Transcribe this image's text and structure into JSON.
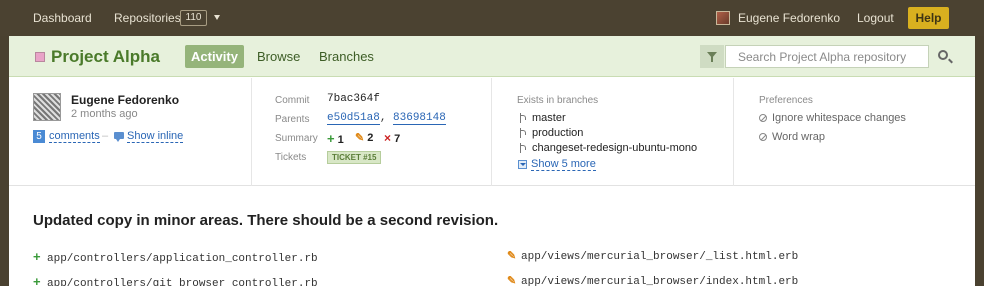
{
  "topnav": {
    "dashboard": "Dashboard",
    "repositories": "Repositories",
    "repo_count": "110",
    "user_name": "Eugene Fedorenko",
    "logout": "Logout",
    "help": "Help"
  },
  "project": {
    "title": "Project Alpha",
    "tabs": [
      {
        "label": "Activity",
        "active": true
      },
      {
        "label": "Browse",
        "active": false
      },
      {
        "label": "Branches",
        "active": false
      }
    ],
    "search_placeholder": "Search Project Alpha repository"
  },
  "author": {
    "name": "Eugene Fedorenko",
    "time": "2 months ago",
    "comments_count": "5",
    "comments_label": "comments",
    "separator": "–",
    "show_inline": "Show inline"
  },
  "commit": {
    "commit_label": "Commit",
    "hash": "7bac364f",
    "parents_label": "Parents",
    "parents": [
      "e50d51a8",
      "83698148"
    ],
    "parents_separator": ",",
    "summary_label": "Summary",
    "added": "1",
    "modified": "2",
    "deleted": "7",
    "tickets_label": "Tickets",
    "ticket": "TICKET #15"
  },
  "branches": {
    "label": "Exists in branches",
    "items": [
      "master",
      "production",
      "changeset-redesign-ubuntu-mono"
    ],
    "show_more": "Show 5 more"
  },
  "preferences": {
    "label": "Preferences",
    "items": [
      "Ignore whitespace changes",
      "Word wrap"
    ]
  },
  "message": "Updated copy in minor areas. There should be a second revision.",
  "files": {
    "left": [
      {
        "status": "added",
        "path": "app/controllers/application_controller.rb"
      },
      {
        "status": "added",
        "path": "app/controllers/git_browser_controller.rb"
      }
    ],
    "right": [
      {
        "status": "modified",
        "path": "app/views/mercurial_browser/_list.html.erb"
      },
      {
        "status": "modified",
        "path": "app/views/mercurial_browser/index.html.erb"
      }
    ]
  },
  "colors": {
    "topbar": "#4b4231",
    "subheader": "#e7f1dc",
    "accent_green": "#4a7a2a",
    "help_button": "#d9b01f",
    "link": "#2a66b5"
  }
}
